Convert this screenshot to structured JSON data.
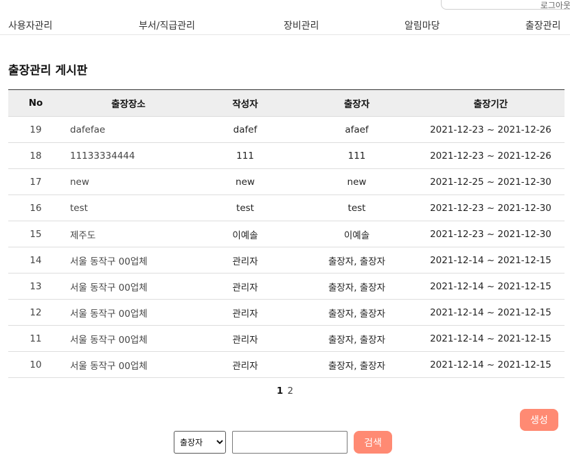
{
  "header": {
    "user_box_text": "로그아웃"
  },
  "nav": {
    "items": [
      {
        "label": "사용자관리"
      },
      {
        "label": "부서/직급관리"
      },
      {
        "label": "장비관리"
      },
      {
        "label": "알림마당"
      },
      {
        "label": "출장관리"
      }
    ]
  },
  "board": {
    "title": "출장관리 게시판",
    "columns": [
      "No",
      "출장장소",
      "작성자",
      "출장자",
      "출장기간"
    ],
    "rows": [
      {
        "no": "19",
        "place": "dafefae",
        "writer": "dafef",
        "traveler": "afaef",
        "period": "2021-12-23 ~ 2021-12-26"
      },
      {
        "no": "18",
        "place": "11133334444",
        "writer": "111",
        "traveler": "111",
        "period": "2021-12-23 ~ 2021-12-26"
      },
      {
        "no": "17",
        "place": "new",
        "writer": "new",
        "traveler": "new",
        "period": "2021-12-25 ~ 2021-12-30"
      },
      {
        "no": "16",
        "place": "test",
        "writer": "test",
        "traveler": "test",
        "period": "2021-12-23 ~ 2021-12-30"
      },
      {
        "no": "15",
        "place": "제주도",
        "writer": "이예솔",
        "traveler": "이예솔",
        "period": "2021-12-23 ~ 2021-12-30"
      },
      {
        "no": "14",
        "place": "서울 동작구 00업체",
        "writer": "관리자",
        "traveler": "출장자, 출장자",
        "period": "2021-12-14 ~ 2021-12-15"
      },
      {
        "no": "13",
        "place": "서울 동작구 00업체",
        "writer": "관리자",
        "traveler": "출장자, 출장자",
        "period": "2021-12-14 ~ 2021-12-15"
      },
      {
        "no": "12",
        "place": "서울 동작구 00업체",
        "writer": "관리자",
        "traveler": "출장자, 출장자",
        "period": "2021-12-14 ~ 2021-12-15"
      },
      {
        "no": "11",
        "place": "서울 동작구 00업체",
        "writer": "관리자",
        "traveler": "출장자, 출장자",
        "period": "2021-12-14 ~ 2021-12-15"
      },
      {
        "no": "10",
        "place": "서울 동작구 00업체",
        "writer": "관리자",
        "traveler": "출장자, 출장자",
        "period": "2021-12-14 ~ 2021-12-15"
      }
    ]
  },
  "pagination": {
    "current": "1",
    "other": "2"
  },
  "actions": {
    "create_label": "생성",
    "search_label": "검색"
  },
  "search": {
    "selected_option": "출장자",
    "input_value": "",
    "input_placeholder": ""
  },
  "colors": {
    "accent": "#ff8a73",
    "header_bg": "#eeeeee"
  }
}
